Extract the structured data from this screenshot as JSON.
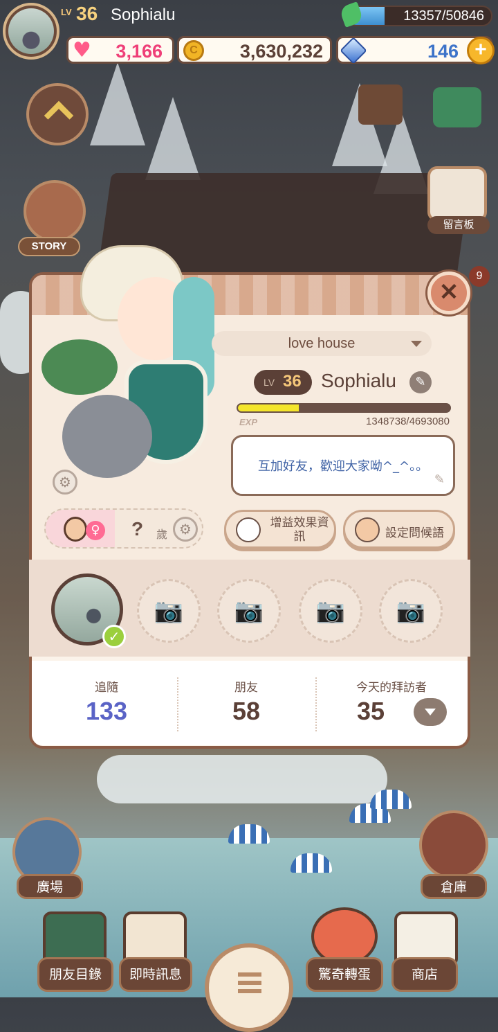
{
  "hud": {
    "lv_label": "LV",
    "level": "36",
    "player_name": "Sophialu",
    "energy": "13357/50846",
    "hearts": "3,166",
    "coins": "3,630,232",
    "coin_symbol": "C",
    "gems": "146",
    "plus": "+"
  },
  "side": {
    "story_label": "STORY",
    "board_label": "留言板",
    "plaza_label": "廣場",
    "storage_label": "倉庫"
  },
  "profile": {
    "close": "✕",
    "notif_count": "9",
    "house_name": "love house",
    "lv_label": "LV",
    "level": "36",
    "name": "Sophialu",
    "edit_icon": "✎",
    "exp_label": "EXP",
    "exp_text": "1348738/4693080",
    "exp_fraction": 0.287,
    "greeting": "互加好友，歡迎大家呦^_^。。",
    "pencil": "✎",
    "gear": "⚙",
    "female_symbol": "♀",
    "age": "?",
    "age_unit": "歲",
    "buff_info_line1": "增益效果資",
    "buff_info_line2": "訊",
    "set_greeting": "設定問候語",
    "check": "✓",
    "camera": "📷"
  },
  "stats": {
    "followers_label": "追隨",
    "followers": "133",
    "friends_label": "朋友",
    "friends": "58",
    "visitors_label": "今天的拜訪者",
    "visitors": "35"
  },
  "nav": {
    "friend_list": "朋友目錄",
    "instant_msg": "即時訊息",
    "gacha": "驚奇轉蛋",
    "shop": "商店"
  },
  "colors": {
    "followers_value": "#5a63c6",
    "other_value": "#5b4037",
    "accent_gold": "#f5c77a"
  }
}
